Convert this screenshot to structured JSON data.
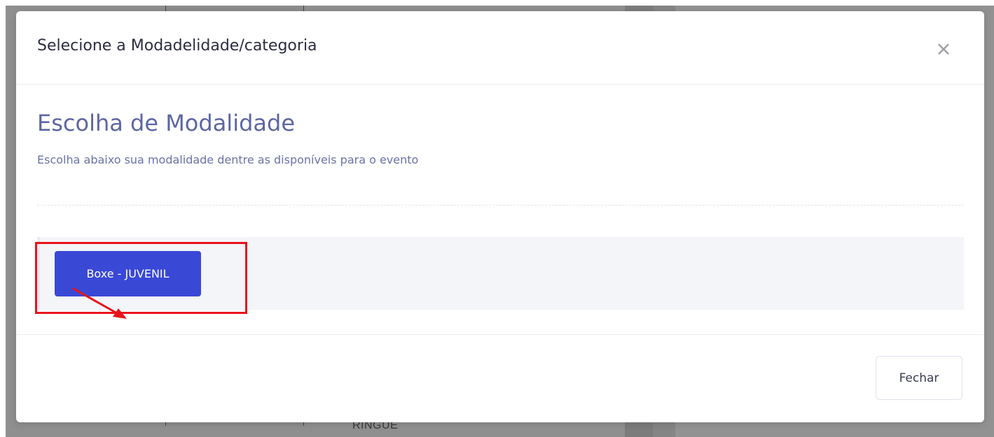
{
  "background": {
    "ringue_text": "RINGUE"
  },
  "modal": {
    "title": "Selecione a Modadelidade/categoria",
    "close_glyph": "×",
    "section_title": "Escolha de Modalidade",
    "section_subtitle": "Escolha abaixo sua modalidade dentre as disponíveis para o evento",
    "options": [
      {
        "label": "Boxe - JUVENIL"
      }
    ],
    "footer": {
      "close_label": "Fechar"
    }
  },
  "annotation": {
    "highlight_color": "#e8141b",
    "arrow_icon": "red-arrow-icon"
  },
  "colors": {
    "primary": "#3a48d6",
    "heading": "#5d66a3"
  }
}
